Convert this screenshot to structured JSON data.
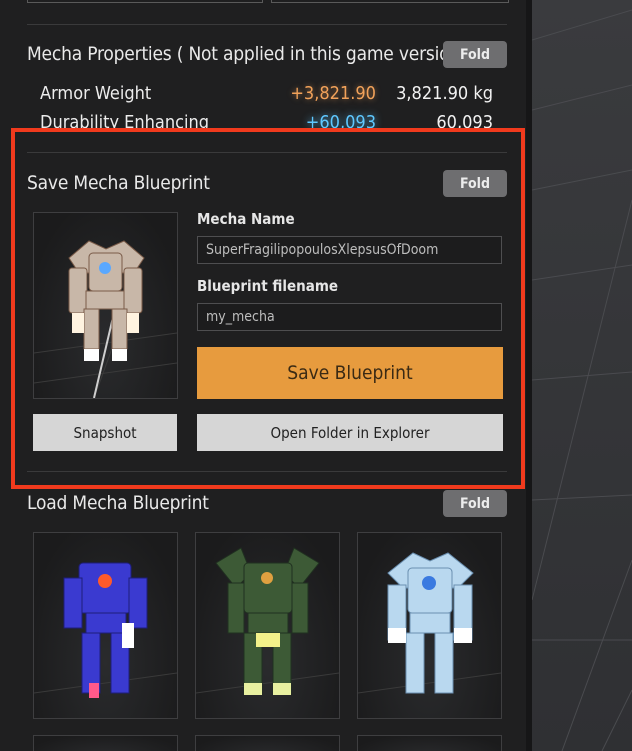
{
  "mecha_properties": {
    "title": "Mecha Properties ( Not applied in this game version )",
    "fold_label": "Fold",
    "rows": [
      {
        "label": "Armor Weight",
        "bonus": "+3,821.90",
        "bonus_color": "#f2a25a",
        "value": "3,821.90 kg"
      },
      {
        "label": "Durability Enhancing",
        "bonus": "+60,093",
        "bonus_color": "#5fc8ff",
        "value": "60,093"
      }
    ]
  },
  "save_blueprint": {
    "title": "Save Mecha Blueprint",
    "fold_label": "Fold",
    "mecha_name_label": "Mecha Name",
    "mecha_name_value": "SuperFragilipopoulosXlepsusOfDoom",
    "filename_label": "Blueprint filename",
    "filename_value": "my_mecha",
    "save_button": "Save Blueprint",
    "snapshot_button": "Snapshot",
    "open_folder_button": "Open Folder in Explorer",
    "accent_color": "#e79b3e",
    "highlight_color": "#f03a1d"
  },
  "load_blueprint": {
    "title": "Load Mecha Blueprint",
    "fold_label": "Fold",
    "thumbnails": [
      {
        "name": "blue-mecha",
        "color": "#3a3ad0"
      },
      {
        "name": "green-mecha",
        "color": "#3d5a36"
      },
      {
        "name": "white-mecha",
        "color": "#b9d8ef"
      }
    ]
  }
}
